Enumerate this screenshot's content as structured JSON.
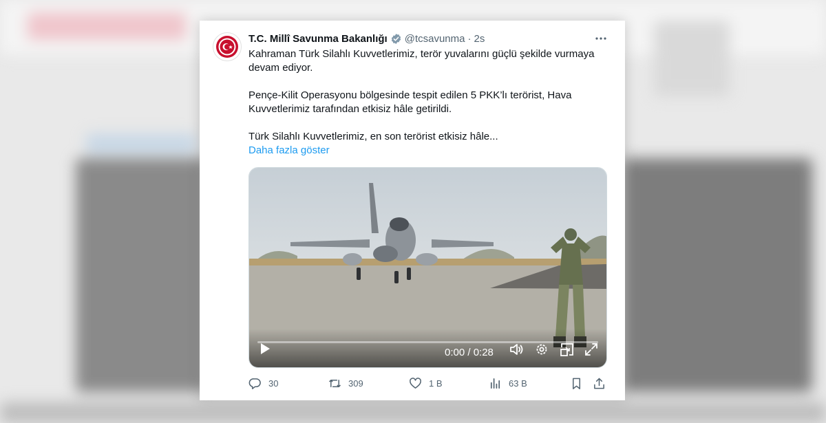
{
  "tweet": {
    "author_name": "T.C. Millî Savunma Bakanlığı",
    "handle": "@tcsavunma",
    "separator": "·",
    "time": "2s",
    "paragraphs": [
      "Kahraman Türk Silahlı Kuvvetlerimiz, terör yuvalarını güçlü şekilde vurmaya devam ediyor.",
      "Pençe-Kilit Operasyonu bölgesinde tespit edilen 5 PKK’lı terörist, Hava Kuvvetlerimiz tarafından etkisiz hâle getirildi.",
      "Türk Silahlı Kuvvetlerimiz, en son terörist etkisiz hâle..."
    ],
    "show_more": "Daha fazla göster",
    "video": {
      "timecode": "0:00 / 0:28",
      "progress": 0
    },
    "stats": {
      "replies": "30",
      "reposts": "309",
      "likes": "1 B",
      "views": "63 B"
    }
  },
  "colors": {
    "accent": "#1d9bf0",
    "text_primary": "#0f1419",
    "text_secondary": "#536471",
    "logo_red": "#c8102e"
  },
  "icons": [
    "verified-badge-icon",
    "more-icon",
    "play-icon",
    "volume-icon",
    "settings-icon",
    "pip-icon",
    "fullscreen-icon",
    "reply-icon",
    "repost-icon",
    "like-icon",
    "views-icon",
    "bookmark-icon",
    "share-icon"
  ]
}
